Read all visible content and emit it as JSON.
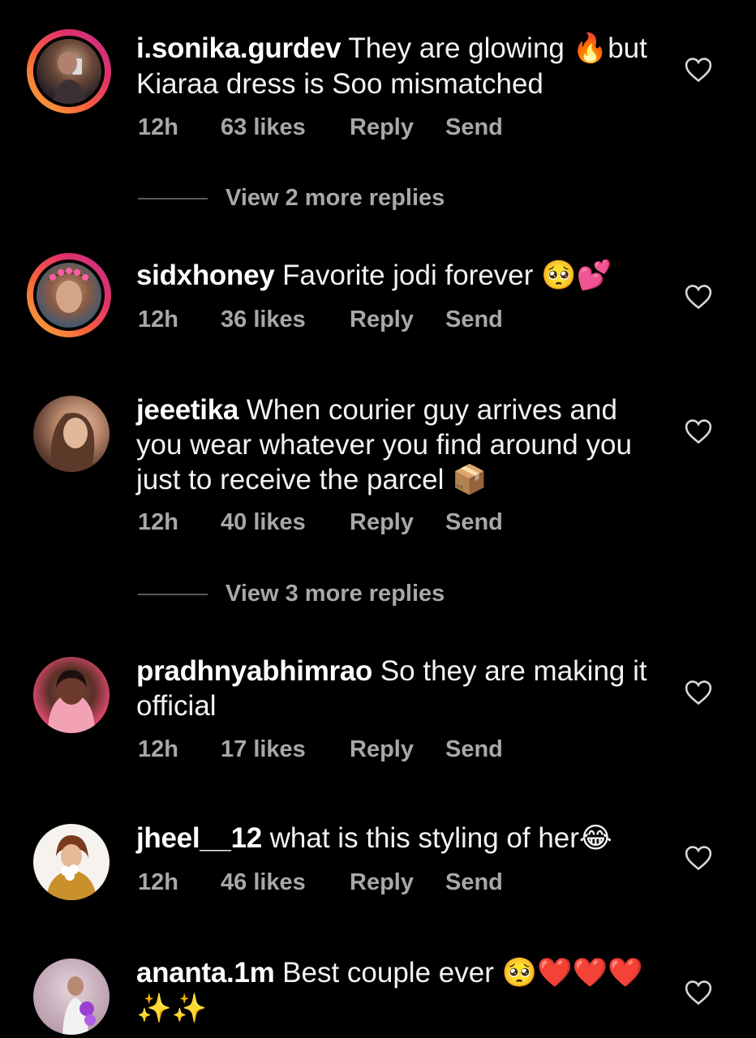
{
  "comments": [
    {
      "username": "i.sonika.gurdev",
      "text_1": " They are glowing ",
      "emoji_1": "🔥",
      "text_2": "but Kiaraa dress is Soo mismatched",
      "time": "12h",
      "likes": "63 likes",
      "reply": "Reply",
      "send": "Send",
      "has_story": true
    },
    {
      "username": "sidxhoney",
      "text_1": " Favorite jodi forever ",
      "emoji_1": "🥺💕",
      "time": "12h",
      "likes": "36 likes",
      "reply": "Reply",
      "send": "Send",
      "has_story": true
    },
    {
      "username": "jeeetika",
      "text_1": " When courier guy arrives and you wear whatever you find around you just to receive the parcel ",
      "emoji_1": "📦",
      "time": "12h",
      "likes": "40 likes",
      "reply": "Reply",
      "send": "Send",
      "has_story": false
    },
    {
      "username": "pradhnyabhimrao",
      "text_1": " So they are making it official",
      "time": "12h",
      "likes": "17 likes",
      "reply": "Reply",
      "send": "Send",
      "has_story": false
    },
    {
      "username": "jheel__12",
      "text_1": " what is this styling of her",
      "emoji_1": "😂",
      "time": "12h",
      "likes": "46 likes",
      "reply": "Reply",
      "send": "Send",
      "has_story": false
    },
    {
      "username": "ananta.1m",
      "text_1": " Best couple ever ",
      "emoji_1": "🥺❤️❤️❤️",
      "emoji_2": "✨✨",
      "has_story": false
    }
  ],
  "view_replies": [
    "View 2 more replies",
    "View 3 more replies"
  ],
  "icons": {
    "like": "heart-outline-icon"
  },
  "colors": {
    "background": "#000000",
    "text": "#f2f2f2",
    "meta": "#a8a8a8",
    "story_ring": "#e1306c"
  }
}
